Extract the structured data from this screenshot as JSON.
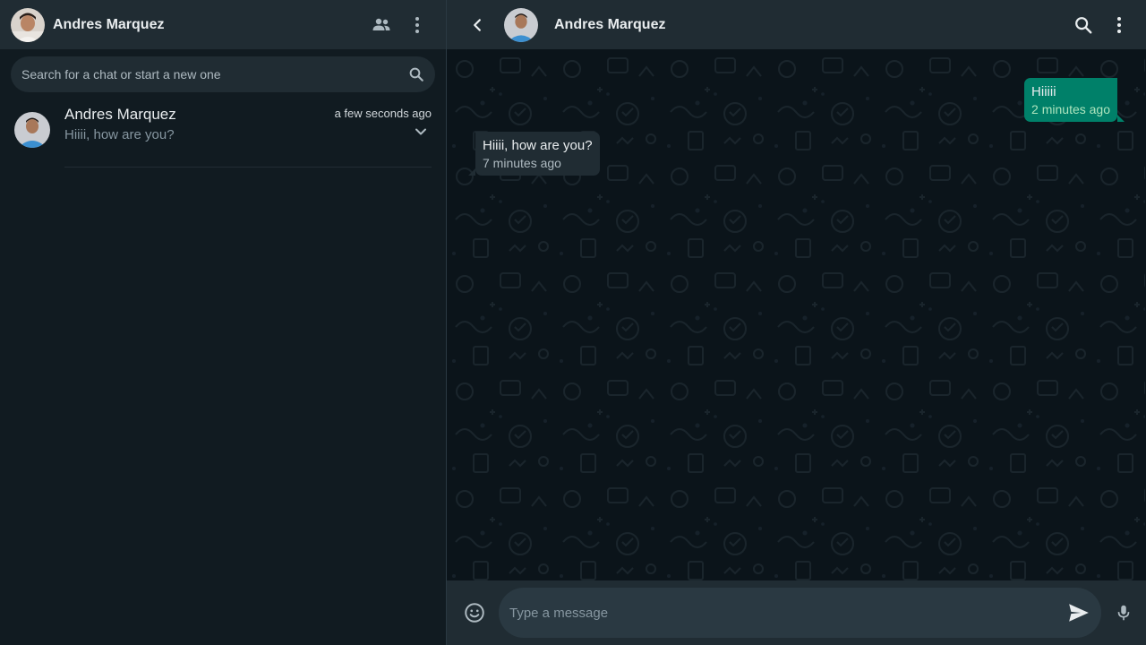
{
  "sidebar": {
    "user_name": "Andres Marquez",
    "search_placeholder": "Search for a chat or start a new one",
    "icons": {
      "community": "community-icon",
      "menu": "kebab-menu-icon",
      "search": "search-icon"
    },
    "chats": [
      {
        "name": "Andres Marquez",
        "time": "a few seconds ago",
        "preview": "Hiiii, how are you?"
      }
    ]
  },
  "chat": {
    "contact_name": "Andres Marquez",
    "messages": [
      {
        "direction": "out",
        "text": "Hiiiii",
        "time": "2 minutes ago"
      },
      {
        "direction": "in",
        "text": "Hiiii, how are you?",
        "time": "7 minutes ago"
      }
    ],
    "composer_placeholder": "Type a message"
  },
  "colors": {
    "panel_bg": "#111b21",
    "header_bg": "#202c33",
    "outgoing_bubble": "#008069",
    "incoming_bubble": "#202c33",
    "text_primary": "#e9edef",
    "text_secondary": "#8696a0"
  }
}
